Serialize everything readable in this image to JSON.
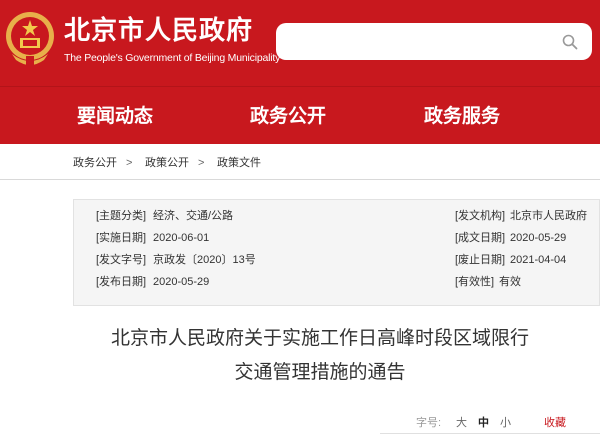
{
  "header": {
    "title": "北京市人民政府",
    "subtitle": "The People's Government of Beijing Municipality",
    "search_placeholder": ""
  },
  "nav": {
    "items": [
      "要闻动态",
      "政务公开",
      "政务服务"
    ]
  },
  "breadcrumb": [
    "政务公开",
    "政策公开",
    "政策文件"
  ],
  "meta": {
    "topic_label": "[主题分类]",
    "topic_value": "经济、交通/公路",
    "effective_label": "[实施日期]",
    "effective_value": "2020-06-01",
    "docno_label": "[发文字号]",
    "docno_value": "京政发〔2020〕13号",
    "publish_label": "[发布日期]",
    "publish_value": "2020-05-29",
    "issuer_label": "[发文机构]",
    "issuer_value": "北京市人民政府",
    "created_label": "[成文日期]",
    "created_value": "2020-05-29",
    "abolish_label": "[废止日期]",
    "abolish_value": "2021-04-04",
    "validity_label": "[有效性]",
    "validity_value": "有效"
  },
  "article": {
    "title_line1": "北京市人民政府关于实施工作日高峰时段区域限行",
    "title_line2": "交通管理措施的通告"
  },
  "font_controls": {
    "label": "字号:",
    "large": "大",
    "medium": "中",
    "small": "小",
    "favorite": "收藏"
  },
  "colors": {
    "brand_red": "#c8181e",
    "favorite_red": "#c8181e"
  }
}
